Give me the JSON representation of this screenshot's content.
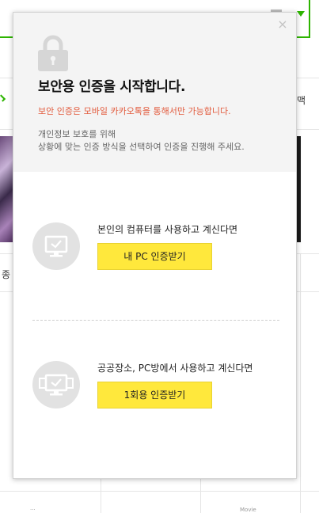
{
  "background": {
    "side_text_top": "맥",
    "side_text_mid": "종",
    "footer_left": "···",
    "footer_right": "Movie"
  },
  "modal": {
    "close_label": "×",
    "title": "보안용 인증을 시작합니다.",
    "notice": "보안 인증은 모바일 카카오톡을 통해서만 가능합니다.",
    "description": [
      "개인정보 보호를 위해",
      "상황에 맞는 인증 방식을 선택하여 인증을 진행해 주세요."
    ],
    "options": [
      {
        "text": "본인의 컴퓨터를 사용하고 계신다면",
        "button": "내 PC 인증받기",
        "icon": "monitor-icon"
      },
      {
        "text": "공공장소, PC방에서 사용하고 계신다면",
        "button": "1회용 인증받기",
        "icon": "multi-monitor-icon"
      }
    ],
    "colors": {
      "accent_button": "#ffe83c",
      "notice": "#e25a3c",
      "header_bg": "#f4f4f4",
      "brand_green": "#2db400"
    }
  }
}
